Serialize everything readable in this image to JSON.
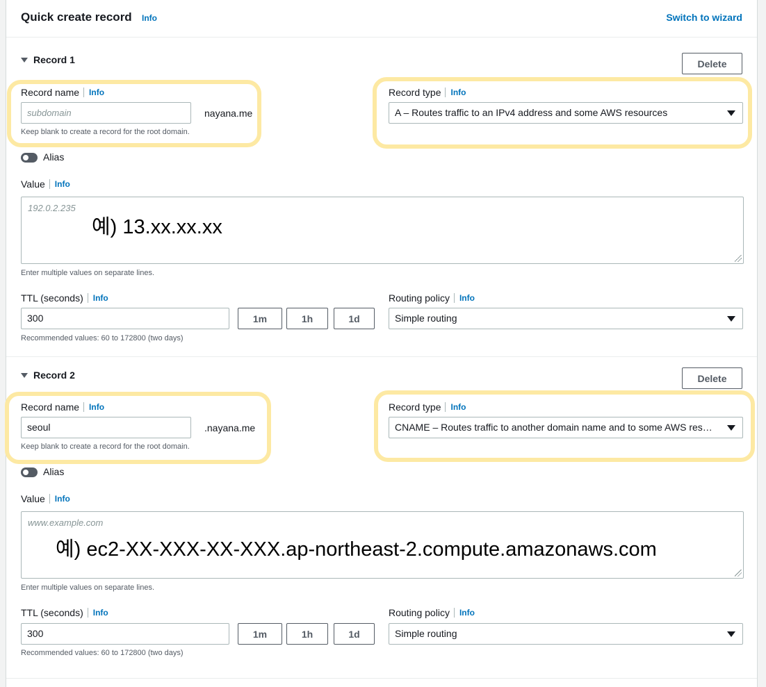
{
  "header": {
    "title": "Quick create record",
    "info": "Info",
    "switch_link": "Switch to wizard"
  },
  "records": [
    {
      "title": "Record 1",
      "delete_label": "Delete",
      "record_name": {
        "label": "Record name",
        "info": "Info",
        "value": "",
        "placeholder": "subdomain",
        "suffix": "nayana.me",
        "hint": "Keep blank to create a record for the root domain."
      },
      "record_type": {
        "label": "Record type",
        "info": "Info",
        "selected": "A – Routes traffic to an IPv4 address and some AWS resources"
      },
      "alias_label": "Alias",
      "value": {
        "label": "Value",
        "info": "Info",
        "placeholder": "192.0.2.235",
        "annotation": "예) 13.xx.xx.xx",
        "hint": "Enter multiple values on separate lines."
      },
      "ttl": {
        "label": "TTL (seconds)",
        "info": "Info",
        "value": "300",
        "buttons": [
          "1m",
          "1h",
          "1d"
        ],
        "hint": "Recommended values: 60 to 172800 (two days)"
      },
      "routing": {
        "label": "Routing policy",
        "info": "Info",
        "selected": "Simple routing"
      }
    },
    {
      "title": "Record 2",
      "delete_label": "Delete",
      "record_name": {
        "label": "Record name",
        "info": "Info",
        "value": "seoul",
        "placeholder": "",
        "suffix": ".nayana.me",
        "hint": "Keep blank to create a record for the root domain."
      },
      "record_type": {
        "label": "Record type",
        "info": "Info",
        "selected": "CNAME – Routes traffic to another domain name and to some AWS resources"
      },
      "alias_label": "Alias",
      "value": {
        "label": "Value",
        "info": "Info",
        "placeholder": "www.example.com",
        "annotation": "예) ec2-XX-XXX-XX-XXX.ap-northeast-2.compute.amazonaws.com",
        "hint": "Enter multiple values on separate lines."
      },
      "ttl": {
        "label": "TTL (seconds)",
        "info": "Info",
        "value": "300",
        "buttons": [
          "1m",
          "1h",
          "1d"
        ],
        "hint": "Recommended values: 60 to 172800 (two days)"
      },
      "routing": {
        "label": "Routing policy",
        "info": "Info",
        "selected": "Simple routing"
      }
    }
  ],
  "colors": {
    "link": "#0073bb",
    "highlight": "#fde9a3",
    "border": "#aab7b8"
  }
}
